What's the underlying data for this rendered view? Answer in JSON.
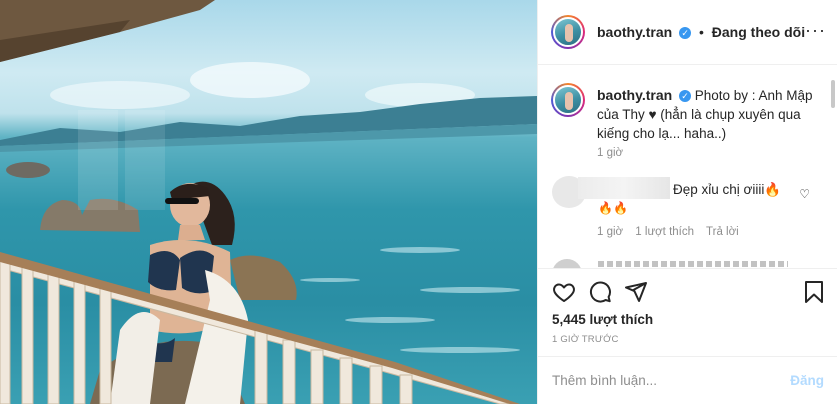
{
  "post": {
    "username": "baothy.tran",
    "follow_status": "Đang theo dõi",
    "caption": "Photo by : Anh Mập của Thy ♥ (hẳn là chụp xuyên qua kiếng cho lạ... haha..)",
    "caption_time": "1 giờ",
    "likes": "5,445 lượt thích",
    "posted_ago": "1 GIỜ TRƯỚC"
  },
  "comment": {
    "text": "Đẹp xỉu chị ơiiii",
    "emoji_inline": "🔥",
    "emoji_line2": "🔥🔥",
    "time": "1 giờ",
    "likes": "1 lượt thích",
    "reply": "Trả lời"
  },
  "add_comment": {
    "placeholder": "Thêm bình luận...",
    "post_label": "Đăng"
  },
  "icons": {
    "more": "more-icon",
    "heart": "heart-icon",
    "comment": "comment-icon",
    "share": "share-icon",
    "save": "bookmark-icon"
  },
  "colors": {
    "verified": "#3897f0",
    "post_button_disabled": "#b3dbff",
    "muted_text": "#8e8e8e"
  }
}
